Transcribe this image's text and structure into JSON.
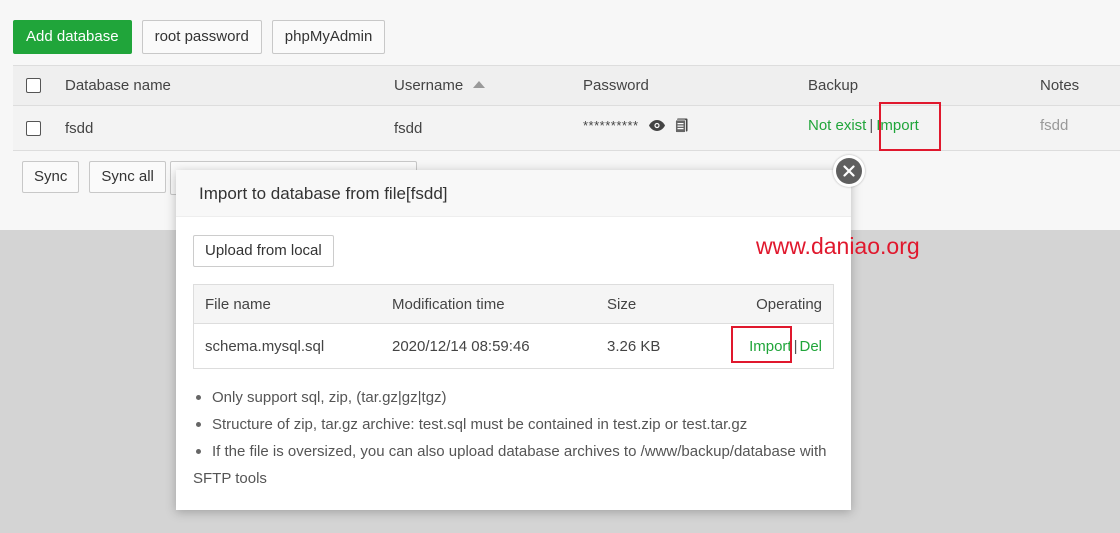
{
  "toolbar": {
    "add_database": "Add database",
    "root_password": "root password",
    "phpmyadmin": "phpMyAdmin"
  },
  "db_table": {
    "headers": {
      "database_name": "Database name",
      "username": "Username",
      "password": "Password",
      "backup": "Backup",
      "notes": "Notes"
    },
    "row": {
      "database_name": "fsdd",
      "username": "fsdd",
      "password_masked": "**********",
      "backup_status": "Not exist",
      "backup_separator": "|",
      "import_link": "Import",
      "notes": "fsdd"
    }
  },
  "bottom_bar": {
    "sync": "Sync",
    "sync_all": "Sync all"
  },
  "modal": {
    "title": "Import to database from file[fsdd]",
    "upload_button": "Upload from local",
    "file_table": {
      "headers": {
        "file_name": "File name",
        "modification_time": "Modification time",
        "size": "Size",
        "operating": "Operating"
      },
      "row": {
        "file_name": "schema.mysql.sql",
        "modification_time": "2020/12/14 08:59:46",
        "size": "3.26 KB",
        "import": "Import",
        "separator": "|",
        "del": "Del"
      }
    },
    "notes": [
      "Only support sql, zip, (tar.gz|gz|tgz)",
      "Structure of zip, tar.gz archive: test.sql must be contained in test.zip or test.tar.gz",
      "If the file is oversized, you can also upload database archives to /www/backup/database with",
      "SFTP tools"
    ]
  },
  "watermark": "www.daniao.org",
  "colors": {
    "accent_green": "#20a53a",
    "highlight_red": "#e0182d"
  }
}
